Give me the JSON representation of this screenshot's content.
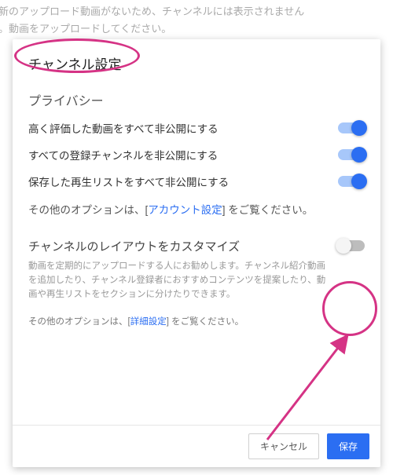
{
  "banner": {
    "line1": "新のアップロード動画がないため、チャンネルには表示されません",
    "line2_prefix": "。動画を",
    "line2_link": "アップロード",
    "line2_suffix": "してください。"
  },
  "dialog": {
    "title": "チャンネル設定",
    "privacy": {
      "heading": "プライバシー",
      "rows": [
        {
          "label": "高く評価した動画をすべて非公開にする",
          "on": true
        },
        {
          "label": "すべての登録チャンネルを非公開にする",
          "on": true
        },
        {
          "label": "保存した再生リストをすべて非公開にする",
          "on": true
        }
      ],
      "more_prefix": "その他のオプションは、[",
      "more_link": "アカウント設定",
      "more_suffix": "] をご覧ください。"
    },
    "layout": {
      "heading": "チャンネルのレイアウトをカスタマイズ",
      "toggle_on": false,
      "help": "動画を定期的にアップロードする人にお勧めします。チャンネル紹介動画を追加したり、チャンネル登録者におすすめコンテンツを提案したり、動画や再生リストをセクションに分けたりできます。",
      "more_prefix": "その他のオプションは、[",
      "more_link": "詳細設定",
      "more_suffix": "] をご覧ください。"
    },
    "footer": {
      "cancel": "キャンセル",
      "save": "保存"
    }
  },
  "colors": {
    "accent": "#2b6ef2",
    "annotation": "#d53385"
  }
}
